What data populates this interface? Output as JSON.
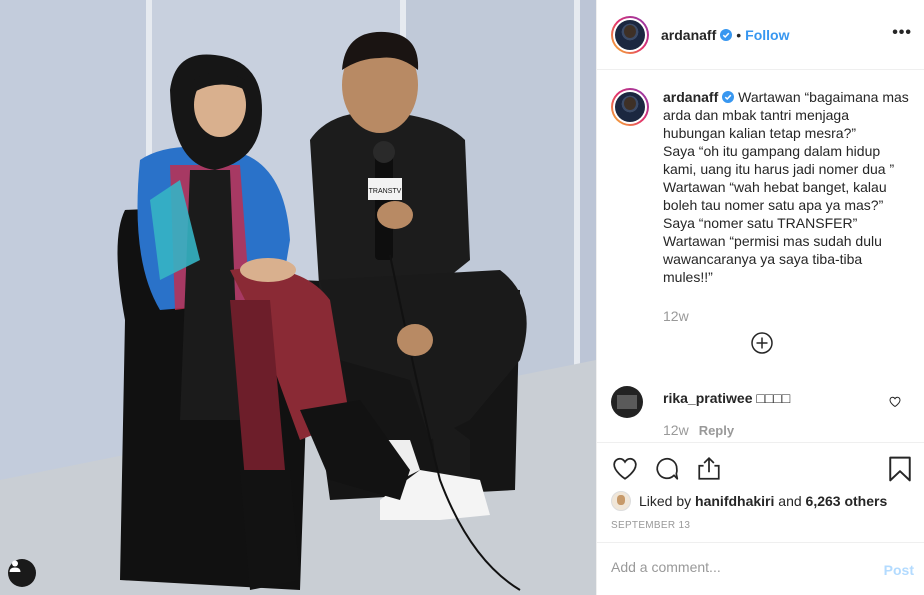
{
  "post": {
    "username": "ardanaff",
    "follow_label": "Follow",
    "dot": "•",
    "more_label": "•••"
  },
  "caption": {
    "username": "ardanaff",
    "text": "Wartawan “bagaimana mas arda dan mbak tantri menjaga hubungan kalian tetap mesra?”\nSaya “oh itu gampang dalam hidup kami, uang itu harus jadi nomer dua ”\nWartawan “wah hebat banget, kalau boleh tau nomer satu apa ya mas?”\nSaya “nomer satu TRANSFER”\nWartawan “permisi mas sudah dulu wawancaranya ya saya tiba-tiba mules!!”",
    "time": "12w"
  },
  "comment": {
    "username": "rika_pratiwee",
    "text": "□□□□",
    "time": "12w",
    "reply_label": "Reply"
  },
  "likes": {
    "prefix": "Liked by",
    "liker": "hanifdhakiri",
    "joiner": "and",
    "others": "6,263 others"
  },
  "date": "SEPTEMBER 13",
  "add_comment": {
    "placeholder": "Add a comment...",
    "post_label": "Post"
  },
  "photo": {
    "mic_flag_text": "TRANSTV"
  },
  "icons": {
    "verified": "verified-badge-icon",
    "heart": "heart-icon",
    "comment": "comment-icon",
    "share": "share-icon",
    "save": "bookmark-icon",
    "load_more": "plus-circle-icon",
    "user_tag": "user-tag-icon"
  },
  "colors": {
    "accent": "#3897f0",
    "muted": "#999999",
    "post_disabled": "#b3dbff"
  }
}
